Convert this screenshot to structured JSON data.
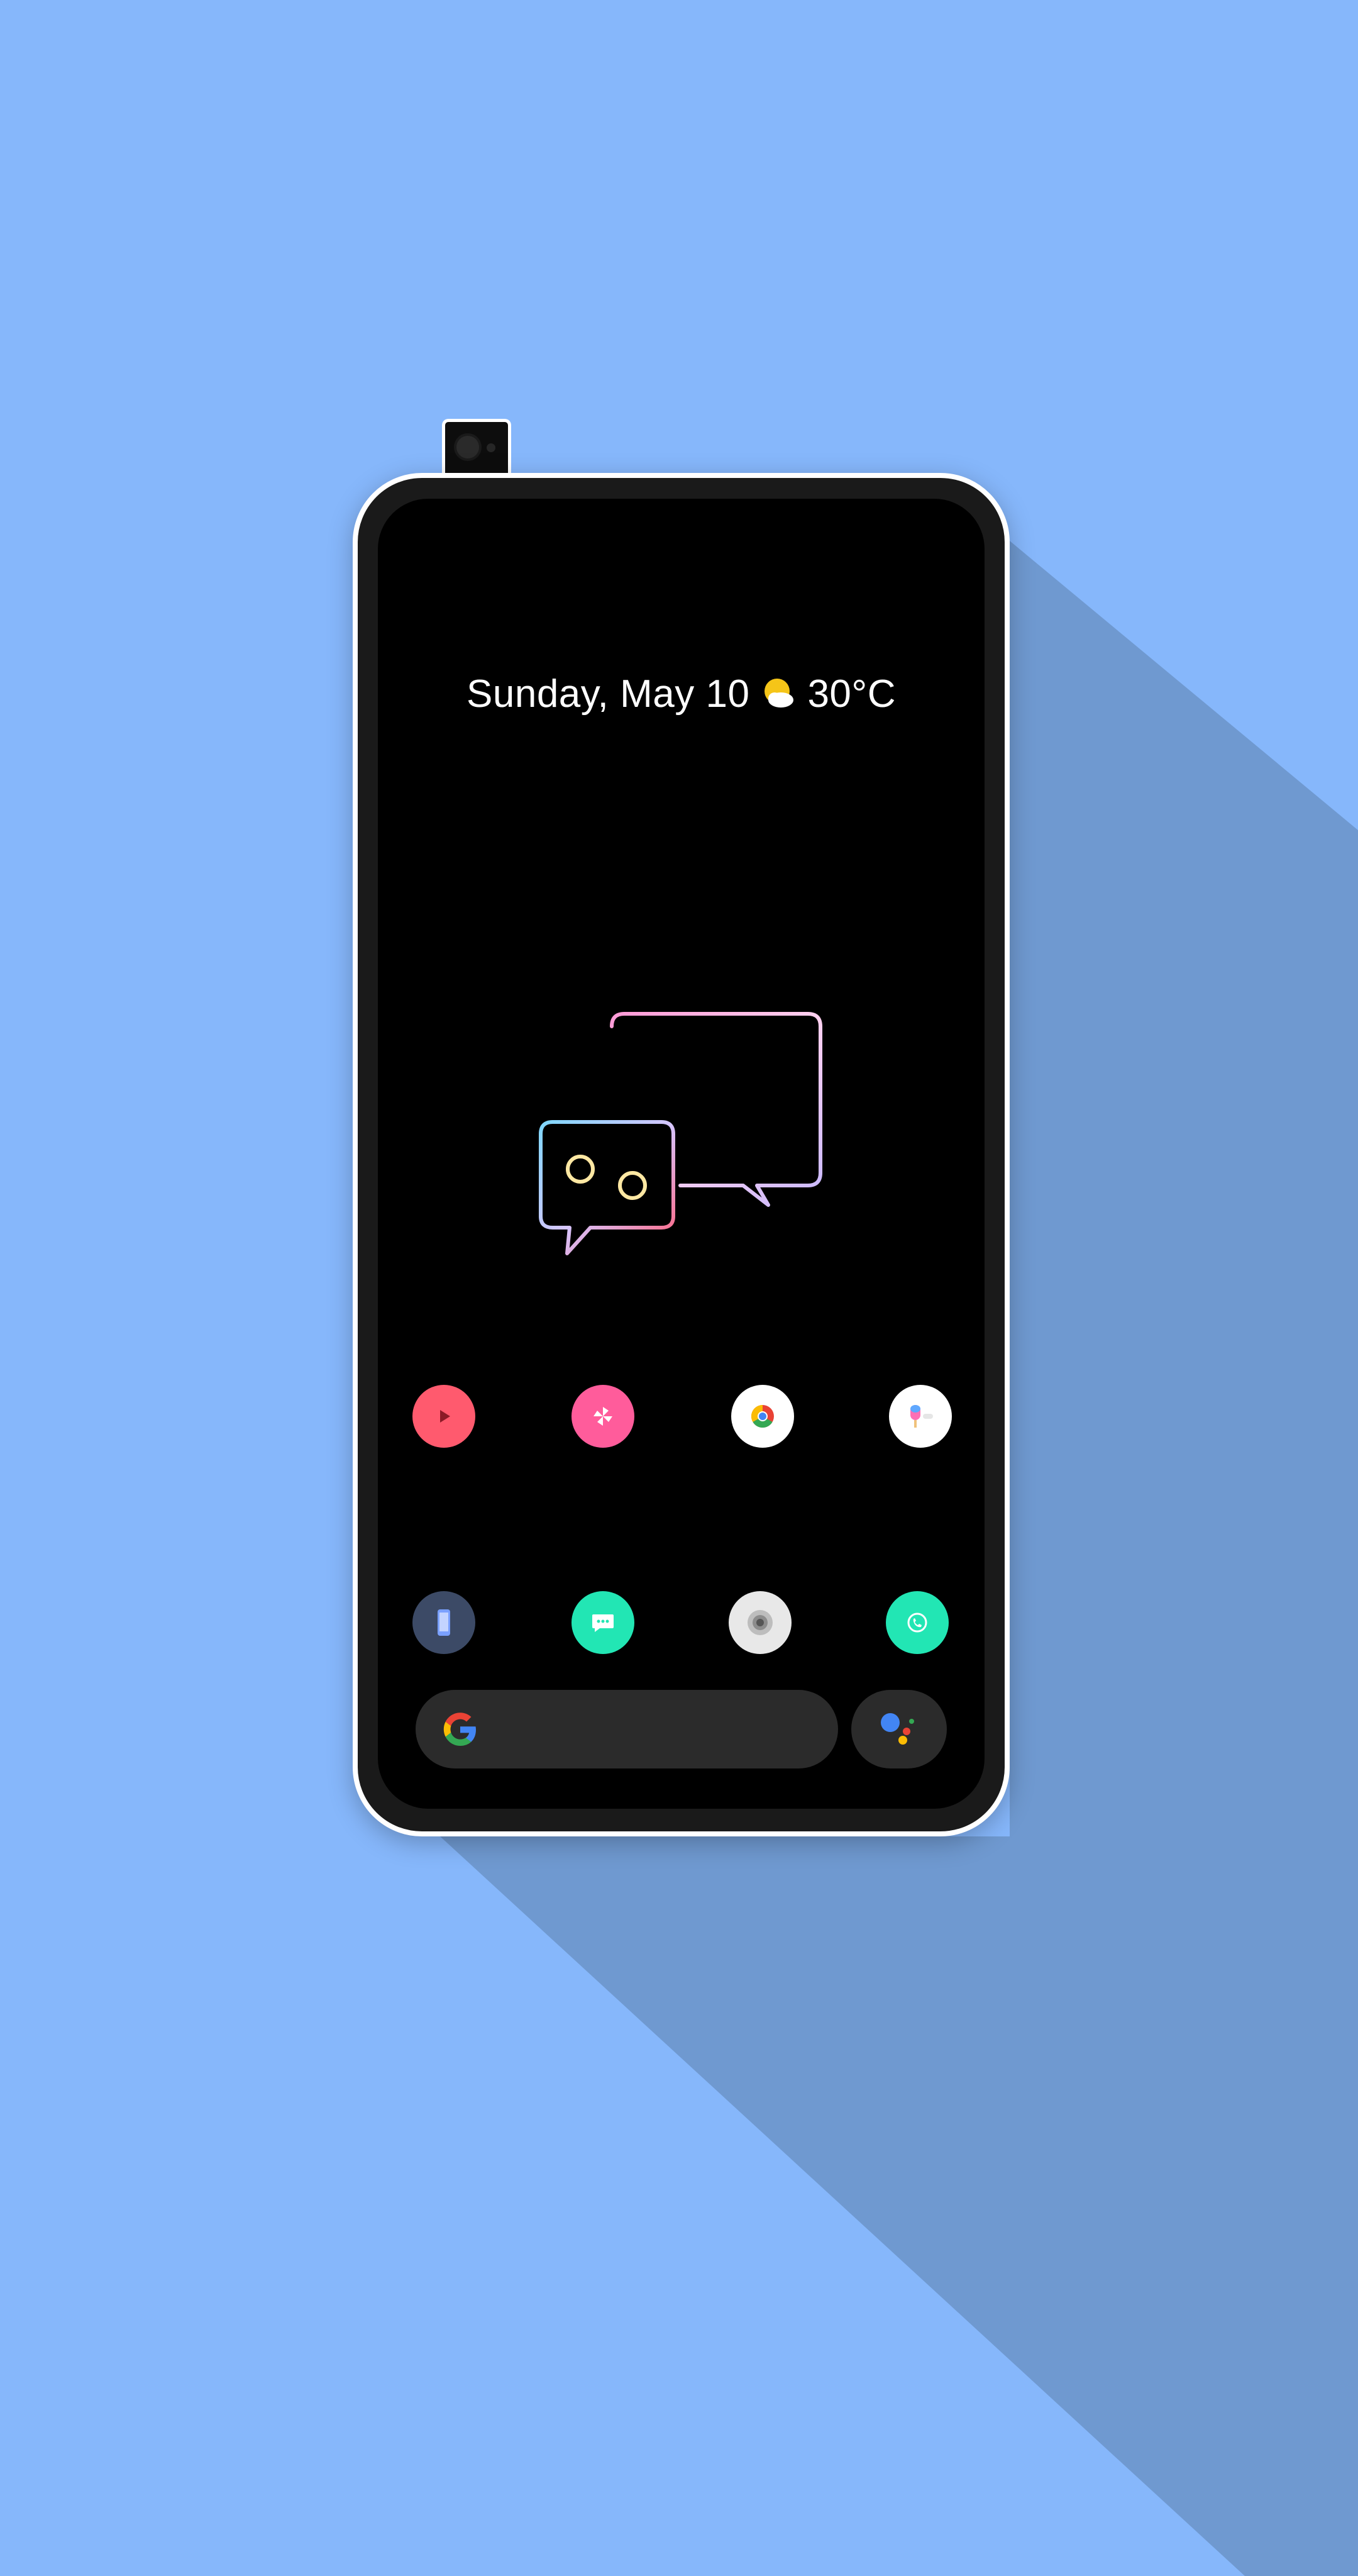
{
  "status": {
    "date_text": "Sunday, May 10",
    "temperature_text": "30°C",
    "weather_icon": "partly-sunny-icon"
  },
  "colors": {
    "background": "#86b7fb",
    "shadow": "#6f99d0",
    "screen": "#000000",
    "bezel": "#1a1a1a",
    "frame": "#ffffff",
    "search_bar": "#2b2b2b"
  },
  "hero_widget": {
    "icon": "chat-bubbles-icon"
  },
  "home_row_1": [
    {
      "icon": "youtube-play-icon",
      "color": "#ff5a6e"
    },
    {
      "icon": "pinwheel-icon",
      "color": "#ff5c9b"
    },
    {
      "icon": "chrome-icon",
      "color": "#ffffff"
    },
    {
      "icon": "popsicle-app-icon",
      "color": "#ffffff"
    }
  ],
  "home_row_2": [
    {
      "icon": "phone-device-icon",
      "color": "#3c4a66"
    },
    {
      "icon": "messages-icon",
      "color": "#22e6b4"
    },
    {
      "icon": "camera-icon",
      "color": "#e8e8e8"
    },
    {
      "icon": "call-icon",
      "color": "#22e6b4"
    }
  ],
  "dock": {
    "search_icon": "google-g-icon",
    "assistant_icon": "google-assistant-icon"
  }
}
